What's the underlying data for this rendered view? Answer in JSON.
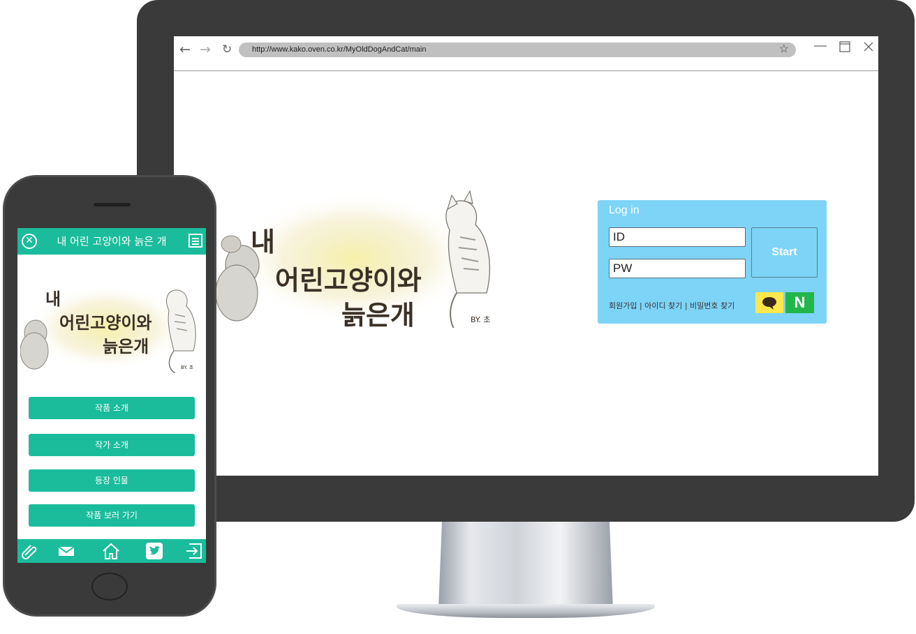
{
  "browser": {
    "url": "http://www.kako.oven.co.kr/MyOldDogAndCat/main",
    "back_icon": "arrow-left-icon",
    "forward_icon": "arrow-right-icon",
    "refresh_icon": "refresh-icon",
    "bookmark_icon": "star-icon",
    "window_controls": [
      "minimize-icon",
      "maximize-icon",
      "close-icon"
    ]
  },
  "page": {
    "title_art": {
      "line1": "내",
      "line2": "어린고양이와",
      "line3": "늙은개",
      "signature": "BY. 초"
    }
  },
  "login": {
    "title": "Log in",
    "id_value": "ID",
    "pw_value": "PW",
    "start_label": "Start",
    "links": [
      "회원가입",
      "아이디 찾기",
      "비밀번호 찾기"
    ],
    "separator": "|",
    "kakao_icon": "kakao-speech-bubble-icon",
    "naver_label": "N",
    "colors": {
      "panel": "#7dd4f7",
      "kakao": "#fbe84a",
      "naver": "#21b64a"
    }
  },
  "mobile": {
    "header_title": "내 어린 고양이와 늙은 개",
    "close_icon": "close-circle-icon",
    "menu_icon": "menu-list-icon",
    "title_art": {
      "line1": "내",
      "line2": "어린고양이와",
      "line3": "늙은개",
      "signature": "BY. 초"
    },
    "menu_buttons": [
      "작품 소개",
      "작가 소개",
      "등장 인물",
      "작품 보러 가기"
    ],
    "footer_icons": [
      "attachment-icon",
      "mail-icon",
      "home-icon",
      "twitter-icon",
      "logout-icon"
    ],
    "colors": {
      "accent": "#1abc9c"
    }
  }
}
